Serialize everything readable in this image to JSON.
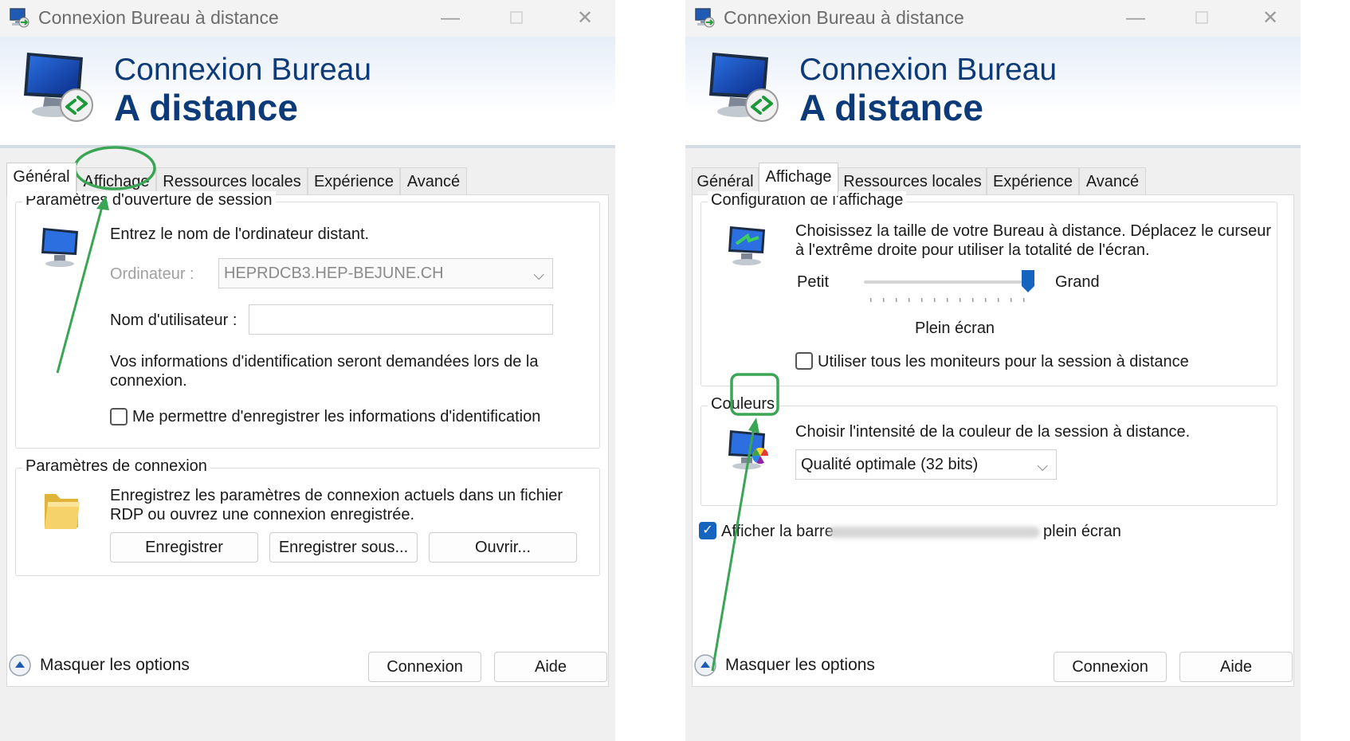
{
  "left": {
    "window_title": "Connexion Bureau à distance",
    "banner_line1": "Connexion Bureau",
    "banner_line2": "A distance",
    "tabs": [
      {
        "label": "Général",
        "active": true
      },
      {
        "label": "Affichage",
        "active": false
      },
      {
        "label": "Ressources locales",
        "active": false
      },
      {
        "label": "Expérience",
        "active": false
      },
      {
        "label": "Avancé",
        "active": false
      }
    ],
    "session_group": {
      "title": "Paramètres d'ouverture de session",
      "instruction": "Entrez le nom de l'ordinateur distant.",
      "computer_label": "Ordinateur :",
      "computer_value": "HEPRDCB3.HEP-BEJUNE.CH",
      "username_label": "Nom d'utilisateur :",
      "username_value": "",
      "info_line1": "Vos informations d'identification seront demandées lors de la",
      "info_line2": "connexion.",
      "save_credentials_label": "Me permettre d'enregistrer les informations d'identification",
      "save_credentials_checked": false
    },
    "connection_group": {
      "title": "Paramètres de connexion",
      "text_line1": "Enregistrez les paramètres de connexion actuels dans un fichier",
      "text_line2": "RDP ou ouvrez une connexion enregistrée.",
      "save_button": "Enregistrer",
      "save_as_button": "Enregistrer sous...",
      "open_button": "Ouvrir..."
    },
    "footer": {
      "hide_options": "Masquer les options",
      "connect_button": "Connexion",
      "help_button": "Aide"
    }
  },
  "right": {
    "window_title": "Connexion Bureau à distance",
    "banner_line1": "Connexion Bureau",
    "banner_line2": "A distance",
    "tabs": [
      {
        "label": "Général",
        "active": false
      },
      {
        "label": "Affichage",
        "active": true
      },
      {
        "label": "Ressources locales",
        "active": false
      },
      {
        "label": "Expérience",
        "active": false
      },
      {
        "label": "Avancé",
        "active": false
      }
    ],
    "display_group": {
      "title": "Configuration de l'affichage",
      "text_line1": "Choisissez la taille de votre Bureau à distance. Déplacez le curseur",
      "text_line2": "à l'extrême droite pour utiliser la totalité de l'écran.",
      "slider_min_label": "Petit",
      "slider_max_label": "Grand",
      "slider_level": 1.0,
      "slider_value_label": "Plein écran",
      "all_monitors_label": "Utiliser tous les moniteurs pour la session à distance",
      "all_monitors_checked": false
    },
    "colors_group": {
      "title": "Couleurs",
      "text": "Choisir l'intensité de la couleur de la session à distance.",
      "color_depth_value": "Qualité optimale (32 bits)"
    },
    "connection_bar_label_start": "Afficher la barre",
    "connection_bar_label_end": "plein écran",
    "connection_bar_checked": true,
    "footer": {
      "hide_options": "Masquer les options",
      "connect_button": "Connexion",
      "help_button": "Aide"
    }
  },
  "colors": {
    "banner_text": "#0d3a78",
    "annotation_green": "#3aa655",
    "checkbox_blue": "#1565c0",
    "slider_thumb": "#1565c0"
  },
  "icons": [
    "remote-desktop-app-icon",
    "monitor-remote-icon",
    "monitor-icon",
    "folder-icon",
    "display-settings-icon",
    "color-monitor-icon",
    "collapse-arrow-icon"
  ]
}
